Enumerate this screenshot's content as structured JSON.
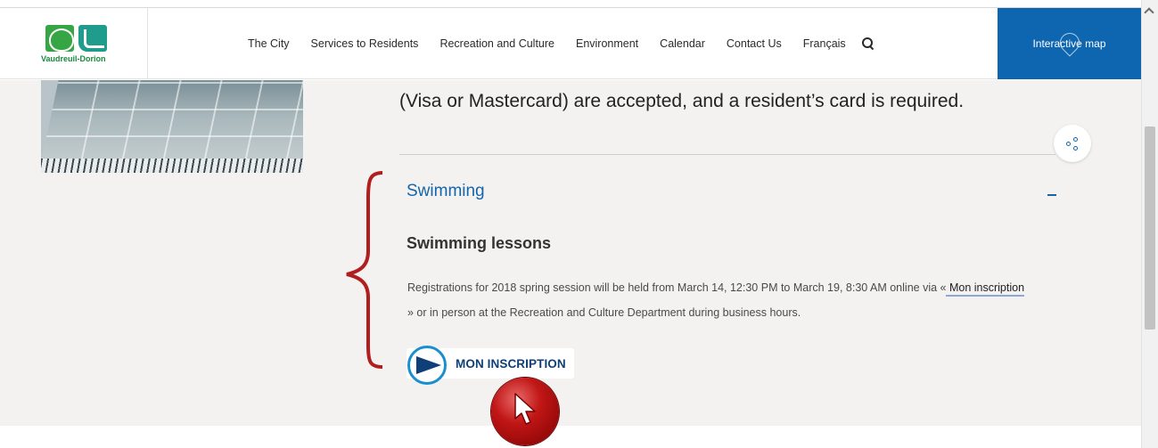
{
  "header": {
    "logo_text": "Vaudreuil-Dorion",
    "nav": [
      {
        "label": "The City"
      },
      {
        "label": "Services to Residents"
      },
      {
        "label": "Recreation and Culture"
      },
      {
        "label": "Environment"
      },
      {
        "label": "Calendar"
      },
      {
        "label": "Contact Us"
      },
      {
        "label": "Français"
      }
    ],
    "search_icon": "search-icon",
    "map_button": "Interactive map",
    "map_icon": "map-pin-icon"
  },
  "content": {
    "intro_text": "(Visa or Mastercard) are accepted, and a resident’s card is required.",
    "share_icon": "share-icon",
    "accordion_title": "Swimming",
    "collapse_icon": "minus-icon",
    "section_title": "Swimming lessons",
    "body_line_1": "Registrations for 2018 spring session will be held from March 14, 12:30 PM to March 19, 8:30 AM online via «",
    "body_link": " Mon inscription",
    "body_line_2": "» or in person at the Recreation and Culture Department during business hours.",
    "inscription_button": "MON INSCRIPTION"
  },
  "colors": {
    "brand_blue": "#0f66b0",
    "accordion_blue": "#1565a8",
    "content_bg": "#f3f2f1",
    "annotation_red": "#b01e1e"
  }
}
